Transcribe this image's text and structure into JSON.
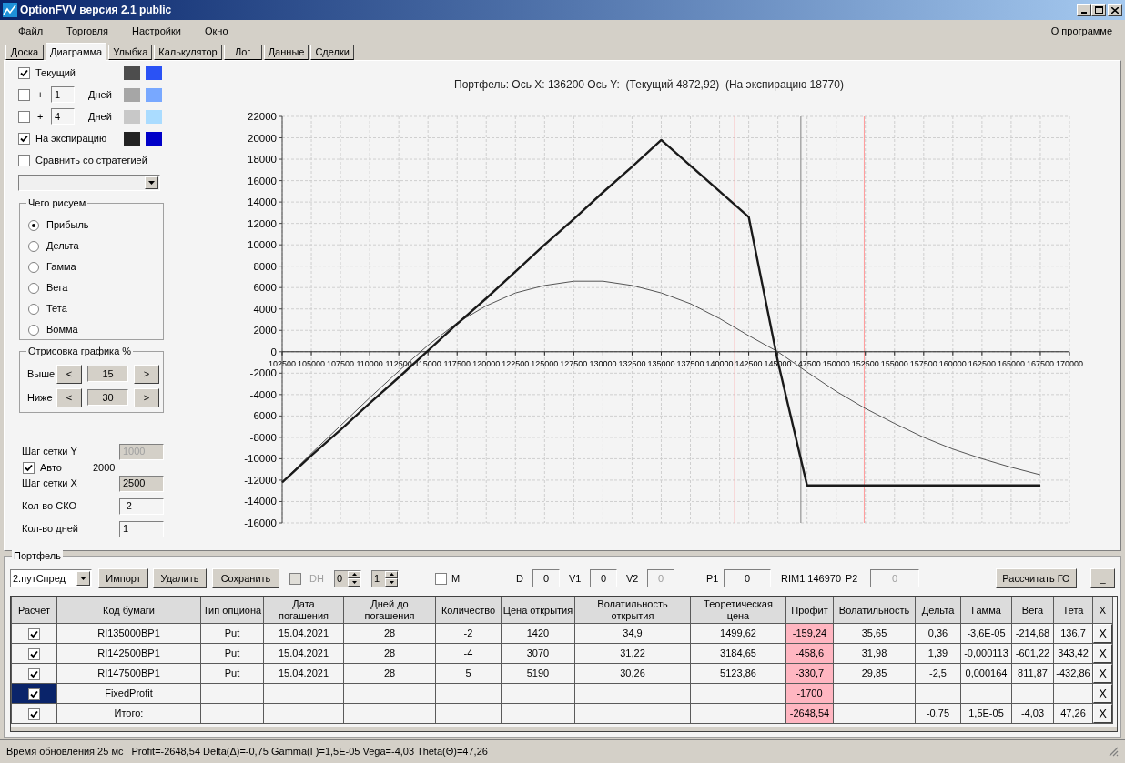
{
  "window": {
    "title": "OptionFVV версия 2.1 public"
  },
  "menu": [
    {
      "label": "Файл"
    },
    {
      "label": "Торговля"
    },
    {
      "label": "Настройки"
    },
    {
      "label": "Окно"
    }
  ],
  "menu_right": {
    "label": "О программе"
  },
  "tabs": [
    {
      "label": "Доска",
      "selected": false
    },
    {
      "label": "Диаграмма",
      "selected": true
    },
    {
      "label": "Улыбка",
      "selected": false
    },
    {
      "label": "Калькулятор",
      "selected": false
    },
    {
      "label": "Лог",
      "selected": false
    },
    {
      "label": "Данные",
      "selected": false
    },
    {
      "label": "Сделки",
      "selected": false
    }
  ],
  "curves": [
    {
      "kind": "fixed",
      "label": "Текущий",
      "checked": true,
      "swatches": [
        {
          "color": "#4d4d4d"
        },
        {
          "color": "#2a52f5"
        }
      ]
    },
    {
      "kind": "offset",
      "prefix": "+",
      "days": "1",
      "label": "Дней",
      "checked": false,
      "swatches": [
        {
          "color": "#a6a6a6"
        },
        {
          "color": "#78a8ff"
        }
      ]
    },
    {
      "kind": "offset",
      "prefix": "+",
      "days": "4",
      "label": "Дней",
      "checked": false,
      "swatches": [
        {
          "color": "#c8c8c8"
        },
        {
          "color": "#aadcff"
        }
      ]
    },
    {
      "kind": "fixed",
      "label": "На экспирацию",
      "checked": true,
      "swatches": [
        {
          "color": "#222222"
        },
        {
          "color": "#0000c8"
        }
      ]
    }
  ],
  "compare": {
    "label": "Сравнить со стратегией",
    "checked": false
  },
  "plot_group": {
    "title": "Чего рисуем",
    "options": [
      {
        "label": "Прибыль",
        "selected": true
      },
      {
        "label": "Дельта",
        "selected": false
      },
      {
        "label": "Гамма",
        "selected": false
      },
      {
        "label": "Вега",
        "selected": false
      },
      {
        "label": "Тета",
        "selected": false
      },
      {
        "label": "Вомма",
        "selected": false
      }
    ]
  },
  "range_group": {
    "title": "Отрисовка графика %",
    "rows": [
      {
        "label": "Выше",
        "dec": "<",
        "value": "15",
        "inc": ">"
      },
      {
        "label": "Ниже",
        "dec": "<",
        "value": "30",
        "inc": ">"
      }
    ]
  },
  "grid_settings": [
    {
      "kind": "field",
      "label": "Шаг сетки Y",
      "value": "1000",
      "disabled": true,
      "readonly": false
    },
    {
      "kind": "check",
      "label": "Авто",
      "checked": true,
      "value": "2000"
    },
    {
      "kind": "field",
      "label": "Шаг сетки X",
      "value": "2500",
      "disabled": false,
      "readonly": true
    },
    {
      "kind": "field",
      "label": "Кол-во СКО",
      "value": "-2",
      "disabled": false,
      "readonly": false
    },
    {
      "kind": "field",
      "label": "Кол-во дней",
      "value": "1",
      "disabled": false,
      "readonly": false
    }
  ],
  "chart": {
    "title": "Портфель: Ось X: 136200 Ось Y:  (Текущий 4872,92)  (На экспирацию 18770)",
    "chart_data": {
      "type": "line",
      "grid": true,
      "x": [
        102500,
        105000,
        107500,
        110000,
        112500,
        115000,
        117500,
        120000,
        122500,
        125000,
        127500,
        130000,
        132500,
        135000,
        137500,
        140000,
        142500,
        145000,
        147500,
        150000,
        152500,
        155000,
        157500,
        160000,
        162500,
        165000,
        167500
      ],
      "series": [
        {
          "color": "#555555",
          "values": [
            -12200,
            -9500,
            -6900,
            -4300,
            -1800,
            600,
            2700,
            4300,
            5500,
            6200,
            6600,
            6600,
            6200,
            5500,
            4500,
            3100,
            1500,
            0,
            -1900,
            -3700,
            -5300,
            -6700,
            -8000,
            -9100,
            -10000,
            -10800,
            -11500
          ]
        },
        {
          "color": "#1a1a1a",
          "values": [
            -12200,
            -9700,
            -7300,
            -4800,
            -2400,
            100,
            2600,
            5000,
            7500,
            10000,
            12400,
            14900,
            17300,
            19800,
            17400,
            15000,
            12600,
            -900,
            -12500,
            -12500,
            -12500,
            -12500,
            -12500,
            -12500,
            -12500,
            -12500,
            -12500
          ]
        }
      ],
      "xlim": [
        102500,
        170000
      ],
      "ylim": [
        -16000,
        22000
      ],
      "xticks": [
        102500,
        105000,
        107500,
        110000,
        112500,
        115000,
        117500,
        120000,
        122500,
        125000,
        127500,
        130000,
        132500,
        135000,
        137500,
        140000,
        142500,
        145000,
        147500,
        150000,
        152500,
        155000,
        157500,
        160000,
        162500,
        165000,
        167500,
        170000
      ],
      "yticks": [
        -16000,
        -14000,
        -12000,
        -10000,
        -8000,
        -6000,
        -4000,
        -2000,
        0,
        2000,
        4000,
        6000,
        8000,
        10000,
        12000,
        14000,
        16000,
        18000,
        20000,
        22000
      ],
      "ref_lines": [
        {
          "axis": "x",
          "value": 141300,
          "color": "#ff9a9a"
        },
        {
          "axis": "x",
          "value": 146970,
          "color": "#808080"
        },
        {
          "axis": "x",
          "value": 152400,
          "color": "#ff9a9a"
        }
      ]
    }
  },
  "portfolio": {
    "title": "Портфель",
    "strategy": "2.путСпред",
    "buttons": [
      {
        "label": "Импорт"
      },
      {
        "label": "Удалить"
      },
      {
        "label": "Сохранить"
      }
    ],
    "dh": {
      "label": "DH",
      "checked": false,
      "disabled": true
    },
    "spinners": [
      {
        "value": "0"
      },
      {
        "value": "1"
      }
    ],
    "m": {
      "label": "M",
      "checked": false
    },
    "fields": [
      {
        "kind": "field",
        "label": "D",
        "value": "0",
        "disabled": false
      },
      {
        "kind": "field",
        "label": "V1",
        "value": "0",
        "disabled": false
      },
      {
        "kind": "field",
        "label": "V2",
        "value": "0",
        "disabled": true
      },
      {
        "kind": "field",
        "label": "P1",
        "value": "0",
        "disabled": false
      },
      {
        "kind": "text",
        "text": "RIM1 146970"
      },
      {
        "kind": "field",
        "label": "P2",
        "value": "0",
        "disabled": true
      }
    ],
    "margin_button": {
      "label": "Рассчитать ГО"
    },
    "collapse_button": {
      "label": "_"
    }
  },
  "table": {
    "columns": [
      {
        "label": "Расчет",
        "kind": "check"
      },
      {
        "label": "Код бумаги",
        "kind": "text"
      },
      {
        "label": "Тип опциона",
        "kind": "text"
      },
      {
        "label": "Дата погашения",
        "kind": "text"
      },
      {
        "label": "Дней до погашения",
        "kind": "text"
      },
      {
        "label": "Количество",
        "kind": "text"
      },
      {
        "label": "Цена открытия",
        "kind": "text"
      },
      {
        "label": "Волатильность открытия",
        "kind": "text"
      },
      {
        "label": "Теоретическая цена",
        "kind": "text"
      },
      {
        "label": "Профит",
        "kind": "profit"
      },
      {
        "label": "Волатильность",
        "kind": "text"
      },
      {
        "label": "Дельта",
        "kind": "text"
      },
      {
        "label": "Гамма",
        "kind": "text"
      },
      {
        "label": "Вега",
        "kind": "text"
      },
      {
        "label": "Тета",
        "kind": "text"
      },
      {
        "label": "X",
        "kind": "delete"
      }
    ],
    "rows": [
      {
        "checked": true,
        "selected": false,
        "cells": [
          "",
          "RI135000BP1",
          "Put",
          "15.04.2021",
          "28",
          "-2",
          "1420",
          "34,9",
          "1499,62",
          "-159,24",
          "35,65",
          "0,36",
          "-3,6E-05",
          "-214,68",
          "136,7",
          "X"
        ]
      },
      {
        "checked": true,
        "selected": false,
        "cells": [
          "",
          "RI142500BP1",
          "Put",
          "15.04.2021",
          "28",
          "-4",
          "3070",
          "31,22",
          "3184,65",
          "-458,6",
          "31,98",
          "1,39",
          "-0,000113",
          "-601,22",
          "343,42",
          "X"
        ]
      },
      {
        "checked": true,
        "selected": false,
        "cells": [
          "",
          "RI147500BP1",
          "Put",
          "15.04.2021",
          "28",
          "5",
          "5190",
          "30,26",
          "5123,86",
          "-330,7",
          "29,85",
          "-2,5",
          "0,000164",
          "811,87",
          "-432,86",
          "X"
        ]
      },
      {
        "checked": true,
        "selected": true,
        "cells": [
          "",
          "FixedProfit",
          "",
          "",
          "",
          "",
          "",
          "",
          "",
          "-1700",
          "",
          "",
          "",
          "",
          "",
          "X"
        ]
      },
      {
        "checked": true,
        "selected": false,
        "cells": [
          "",
          "Итого:",
          "",
          "",
          "",
          "",
          "",
          "",
          "",
          "-2648,54",
          "",
          "-0,75",
          "1,5E-05",
          "-4,03",
          "47,26",
          "X"
        ]
      }
    ]
  },
  "status_bar": {
    "update_time": "Время обновления 25 мс",
    "summary": "Profit=-2648,54 Delta(Δ)=-0,75 Gamma(Γ)=1,5E-05 Vega=-4,03 Theta(Θ)=47,26"
  }
}
